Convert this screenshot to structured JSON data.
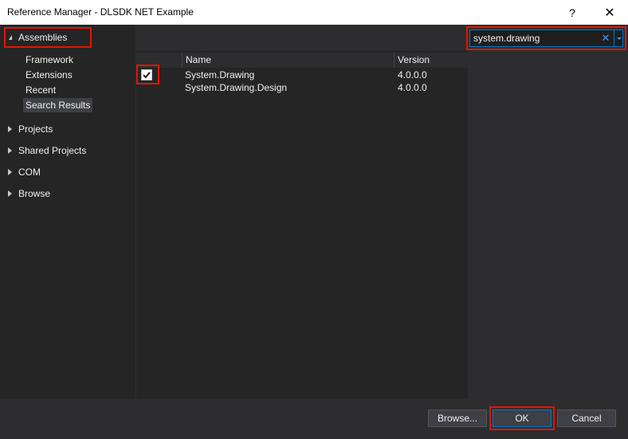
{
  "window": {
    "title": "Reference Manager - DLSDK NET Example",
    "help_label": "?",
    "close_label": "✕"
  },
  "nav": {
    "assemblies_label": "Assemblies",
    "sub_items": [
      "Framework",
      "Extensions",
      "Recent",
      "Search Results"
    ],
    "selected_sub_item": "Search Results",
    "tree_items": [
      "Projects",
      "Shared Projects",
      "COM",
      "Browse"
    ]
  },
  "table": {
    "columns": {
      "name": "Name",
      "version": "Version"
    },
    "rows": [
      {
        "checked": true,
        "name": "System.Drawing",
        "version": "4.0.0.0"
      },
      {
        "checked": false,
        "name": "System.Drawing.Design",
        "version": "4.0.0.0"
      }
    ]
  },
  "search": {
    "value": "system.drawing",
    "clear_label": "✕"
  },
  "buttons": {
    "browse": "Browse...",
    "ok": "OK",
    "cancel": "Cancel"
  },
  "colors": {
    "highlight": "#e51400",
    "accent": "#007acc",
    "background": "#2d2d30",
    "panel": "#252526"
  }
}
